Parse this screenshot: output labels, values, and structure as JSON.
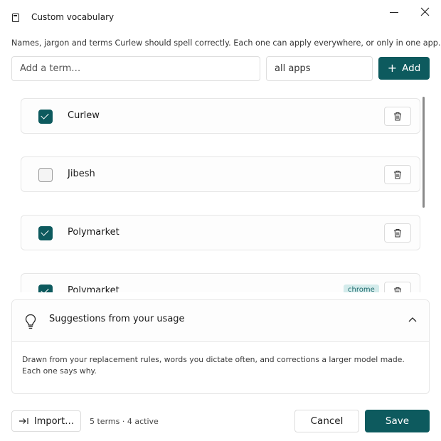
{
  "window": {
    "title": "Custom vocabulary",
    "app_icon": "notebook-icon",
    "minimize_icon": "minimize-icon",
    "close_icon": "close-icon"
  },
  "intro": "Names, jargon and terms Curlew should spell correctly. Each one can apply everywhere, or only in one app.",
  "add_row": {
    "placeholder": "Add a term…",
    "scope_value": "all apps",
    "add_label": "Add",
    "add_icon": "plus-icon"
  },
  "terms": [
    {
      "label": "Curlew",
      "checked": true,
      "scope": ""
    },
    {
      "label": "Jibesh",
      "checked": false,
      "scope": ""
    },
    {
      "label": "Polymarket",
      "checked": true,
      "scope": ""
    },
    {
      "label": "Polymarket",
      "checked": true,
      "scope": "chrome"
    }
  ],
  "suggestions": {
    "title": "Suggestions from your usage",
    "icon": "lightbulb-icon",
    "toggle_icon": "chevron-up-icon",
    "description": "Drawn from your replacement rules, words you dictate often, and corrections a larger model made. Each one says why."
  },
  "footer": {
    "import_label": "Import…",
    "import_icon": "import-arrow-icon",
    "count": "5 terms · 4 active",
    "cancel_label": "Cancel",
    "save_label": "Save"
  },
  "colors": {
    "accent": "#0d5a5e",
    "chip_bg": "#d3ebeb",
    "chip_text": "#1d6a6c"
  }
}
